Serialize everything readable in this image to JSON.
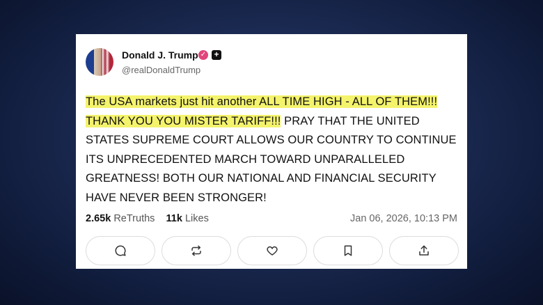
{
  "post": {
    "author_name": "Donald J. Trump",
    "author_handle": "@realDonaldTrump",
    "verified_mark": "✓",
    "plus_badge": "+",
    "highlighted_text": "The USA markets just hit another ALL TIME HIGH - ALL OF THEM!!! THANK YOU YOU MISTER TARIFF!!!",
    "body_text": " PRAY THAT THE UNITED STATES SUPREME COURT ALLOWS OUR COUNTRY TO CONTINUE ITS UNPRECEDENTED MARCH TOWARD UNPARALLELED GREATNESS! BOTH OUR NATIONAL AND FINANCIAL SECURITY HAVE NEVER BEEN STRONGER!",
    "retruths_count": "2.65k",
    "retruths_label": "ReTruths",
    "likes_count": "11k",
    "likes_label": "Likes",
    "timestamp": "Jan 06, 2026, 10:13 PM"
  },
  "actions": [
    {
      "name": "reply",
      "icon": "comment-icon"
    },
    {
      "name": "retruth",
      "icon": "repost-icon"
    },
    {
      "name": "like",
      "icon": "heart-icon"
    },
    {
      "name": "bookmark",
      "icon": "bookmark-icon"
    },
    {
      "name": "share",
      "icon": "share-icon"
    }
  ],
  "colors": {
    "highlight": "#f4f36c",
    "verified": "#e0457b",
    "background": "#1b2a52"
  }
}
